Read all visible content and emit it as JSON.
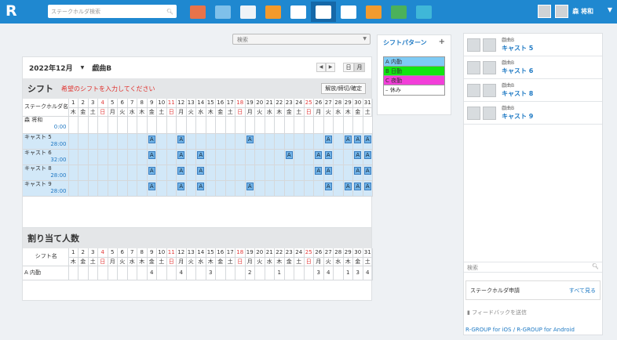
{
  "header": {
    "logo": "R",
    "search_placeholder": "ステークホルダ検索",
    "user_name": "森 将和",
    "caret": "▼"
  },
  "apps": [
    {
      "name": "calendar-icon",
      "color": "#e8734a"
    },
    {
      "name": "window-icon",
      "color": "#7fc0ea"
    },
    {
      "name": "mail-icon",
      "color": "#eef3f7"
    },
    {
      "name": "folder-icon",
      "color": "#f39a2b"
    },
    {
      "name": "clock-icon",
      "color": "#ffffff"
    },
    {
      "name": "notepad-icon",
      "color": "#ffffff"
    },
    {
      "name": "card-icon",
      "color": "#ffffff"
    },
    {
      "name": "people-icon",
      "color": "#f29b2e"
    },
    {
      "name": "monitor-icon",
      "color": "#4bb15a"
    },
    {
      "name": "chat-icon",
      "color": "#3fb7d8"
    }
  ],
  "main": {
    "search_dropdown": "検索",
    "month": "2022年12月",
    "dropdown_arrow": "▼",
    "group": "戯曲B",
    "nav_prev": "◀",
    "nav_next": "▶",
    "view_day": "日",
    "view_month": "月",
    "shift_section": {
      "title": "シフト",
      "notice": "希望のシフトを入力してください",
      "action_button": "解放/締切/確定"
    },
    "stakeholder_header": "ステークホルダ名",
    "days": [
      "1",
      "2",
      "3",
      "4",
      "5",
      "6",
      "7",
      "8",
      "9",
      "10",
      "11",
      "12",
      "13",
      "14",
      "15",
      "16",
      "17",
      "18",
      "19",
      "20",
      "21",
      "22",
      "23",
      "24",
      "25",
      "26",
      "27",
      "28",
      "29",
      "30",
      "31"
    ],
    "weekdays": [
      "木",
      "金",
      "土",
      "日",
      "月",
      "火",
      "水",
      "木",
      "金",
      "土",
      "日",
      "月",
      "火",
      "水",
      "木",
      "金",
      "土",
      "日",
      "月",
      "火",
      "水",
      "木",
      "金",
      "土",
      "日",
      "月",
      "火",
      "水",
      "木",
      "金",
      "土"
    ],
    "red_days": [
      4,
      11,
      18,
      25
    ],
    "me": {
      "name": "森 将和",
      "hours": "0:00"
    },
    "casts": [
      {
        "name": "キャスト 5",
        "hours": "28:00",
        "days": [
          9,
          12,
          19,
          27,
          29,
          30,
          31
        ]
      },
      {
        "name": "キャスト 6",
        "hours": "32:00",
        "days": [
          9,
          12,
          14,
          23,
          26,
          27,
          30,
          31
        ]
      },
      {
        "name": "キャスト 8",
        "hours": "28:00",
        "days": [
          9,
          12,
          14,
          26,
          27,
          30,
          31
        ]
      },
      {
        "name": "キャスト 9",
        "hours": "28:00",
        "days": [
          9,
          12,
          14,
          19,
          27,
          29,
          30,
          31
        ]
      }
    ],
    "shift_mark": "A",
    "assign_section": {
      "title": "割り当て人数",
      "shift_name_header": "シフト名",
      "row_label": "A 内勤",
      "counts": {
        "9": "4",
        "12": "4",
        "15": "3",
        "19": "2",
        "22": "1",
        "26": "3",
        "27": "4",
        "29": "1",
        "30": "3",
        "31": "4"
      }
    }
  },
  "patterns": {
    "title": "シフトパターン",
    "add": "+",
    "items": [
      {
        "label": "A 内勤",
        "color": "#7ecbf5"
      },
      {
        "label": "B 日勤",
        "color": "#11e611"
      },
      {
        "label": "C 夜勤",
        "color": "#f23fd9"
      },
      {
        "label": "– 休み",
        "color": "#ffffff"
      }
    ]
  },
  "sidebar": {
    "items": [
      {
        "sub": "戯曲B",
        "main": "キャスト 5"
      },
      {
        "sub": "戯曲B",
        "main": "キャスト 6"
      },
      {
        "sub": "戯曲B",
        "main": "キャスト 8"
      },
      {
        "sub": "戯曲B",
        "main": "キャスト 9"
      }
    ],
    "search_placeholder": "検索",
    "request_label": "ステークホルダ申請",
    "see_all": "すべて見る",
    "feedback": "フィードバックを送信",
    "links": "R-GROUP for iOS / R-GROUP for Android"
  }
}
